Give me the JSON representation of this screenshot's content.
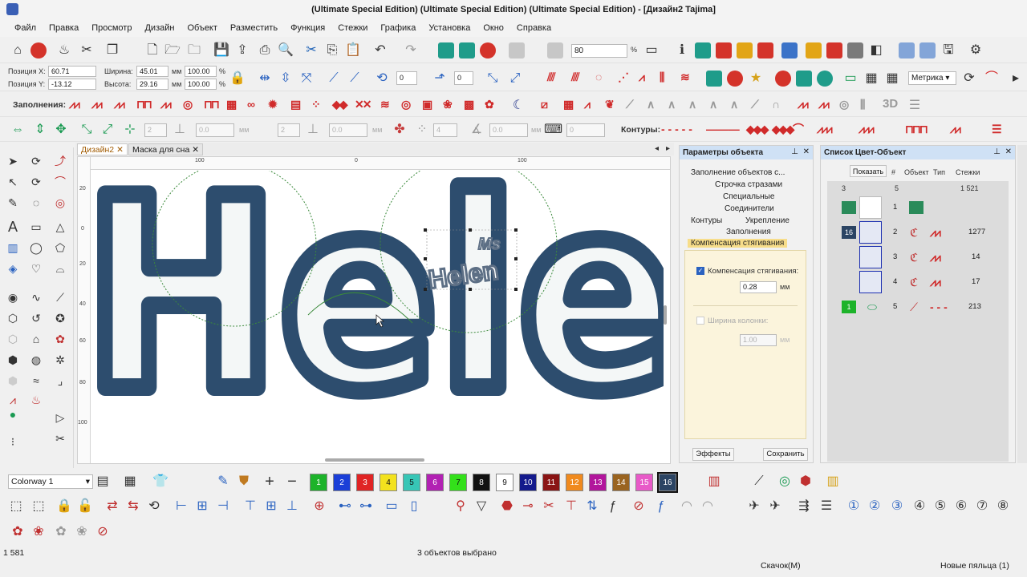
{
  "window": {
    "title": "(Ultimate Special Edition) (Ultimate Special Edition) (Ultimate Special Edition) - [Дизайн2     Tajima]"
  },
  "menu": [
    "Файл",
    "Правка",
    "Просмотр",
    "Дизайн",
    "Объект",
    "Разместить",
    "Функция",
    "Стежки",
    "Графика",
    "Установка",
    "Окно",
    "Справка"
  ],
  "toolbar1": {
    "zoom_value": "80",
    "zoom_unit": "%"
  },
  "toolbar2": {
    "pos_x_label": "Позиция X:",
    "pos_x_value": "60.71",
    "pos_y_label": "Позиция Y:",
    "pos_y_value": "-13.12",
    "width_label": "Ширина:",
    "width_value": "45.01",
    "height_label": "Высота:",
    "height_value": "29.16",
    "unit_mm": "мм",
    "scale_x": "100.00",
    "scale_y": "100.00",
    "percent": "%",
    "rotate_value": "0",
    "slant_value": "0",
    "units_select": "Метрика"
  },
  "toolbar3": {
    "fills_label": "Заполнения:",
    "three_d": "3D"
  },
  "toolbar4": {
    "contours_label": "Контуры:",
    "f1": "2",
    "f2": "0.0",
    "f3": "2",
    "f4": "0.0",
    "f5": "4",
    "f6": "0.0",
    "f7": "0",
    "unit": "мм"
  },
  "document_tabs": [
    "Дизайн2",
    "Маска для сна"
  ],
  "canvas": {
    "h_ruler": [
      "100",
      "0",
      "100"
    ],
    "v_ruler": [
      "20",
      "0",
      "20",
      "40",
      "60",
      "80",
      "100"
    ],
    "design_text": "Hele",
    "patch_small": "Ms",
    "patch_main": "Helen"
  },
  "object_props": {
    "title": "Параметры объекта",
    "tabs": [
      "Заполнение объектов с...",
      "Строчка стразами",
      "Специальные",
      "Соединители",
      "Контуры",
      "Укрепление",
      "Заполнения",
      "Компенсация стягивания"
    ],
    "pull_comp_label": "Компенсация стягивания:",
    "pull_comp_value": "0.28",
    "unit": "мм",
    "column_width_label": "Ширина колонки:",
    "column_width_value": "1.00",
    "effects_button": "Эффекты",
    "save_button": "Сохранить"
  },
  "color_object_list": {
    "title": "Список Цвет-Объект",
    "show_button": "Показать",
    "columns": [
      "#",
      "Объект",
      "Тип",
      "Стежки"
    ],
    "summary": [
      "3",
      "5",
      "1 521"
    ],
    "rows": [
      {
        "color": "",
        "num": "1",
        "stitches": ""
      },
      {
        "color": "16",
        "num": "2",
        "stitches": "1277"
      },
      {
        "color": "",
        "num": "3",
        "stitches": "14"
      },
      {
        "color": "",
        "num": "4",
        "stitches": "17"
      },
      {
        "color": "1",
        "num": "5",
        "stitches": "213"
      }
    ]
  },
  "palette": {
    "colorway": "Colorway 1",
    "swatches": [
      {
        "n": "1",
        "c": "#1db32a"
      },
      {
        "n": "2",
        "c": "#1b3fd8"
      },
      {
        "n": "3",
        "c": "#e02424"
      },
      {
        "n": "4",
        "c": "#f3e21e"
      },
      {
        "n": "5",
        "c": "#37c6b6"
      },
      {
        "n": "6",
        "c": "#b221b3"
      },
      {
        "n": "7",
        "c": "#33e01a"
      },
      {
        "n": "8",
        "c": "#111111"
      },
      {
        "n": "9",
        "c": "#ffffff"
      },
      {
        "n": "10",
        "c": "#141a8c"
      },
      {
        "n": "11",
        "c": "#8a1414"
      },
      {
        "n": "12",
        "c": "#f08a1e"
      },
      {
        "n": "13",
        "c": "#b2169c"
      },
      {
        "n": "14",
        "c": "#9a6420"
      },
      {
        "n": "15",
        "c": "#e85ac8"
      },
      {
        "n": "16",
        "c": "#2b4463"
      }
    ]
  },
  "statusbar": {
    "stitch_count": "1 581",
    "selection": "3 объектов выбрано",
    "jump": "Скачок(M)",
    "hoop": "Новые пяльца (1)"
  }
}
